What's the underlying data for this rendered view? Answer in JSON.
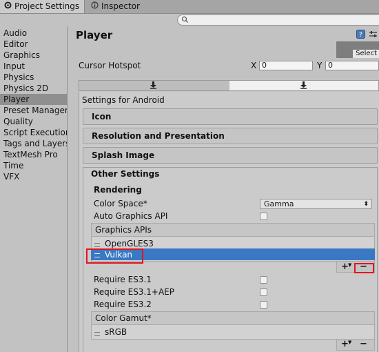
{
  "tabs": [
    {
      "label": "Project Settings",
      "icon": "gear-icon"
    },
    {
      "label": "Inspector",
      "icon": "info-icon"
    }
  ],
  "sidebar": {
    "items": [
      "Audio",
      "Editor",
      "Graphics",
      "Input",
      "Physics",
      "Physics 2D",
      "Player",
      "Preset Manager",
      "Quality",
      "Script Execution",
      "Tags and Layers",
      "TextMesh Pro",
      "Time",
      "VFX"
    ],
    "selected": "Player"
  },
  "main": {
    "title": "Player",
    "select_button": "Select",
    "cursor_hotspot": {
      "label": "Cursor Hotspot",
      "x_label": "X",
      "x_value": "0",
      "y_label": "Y",
      "y_value": "0"
    },
    "settings_for": "Settings for Android",
    "sections": [
      "Icon",
      "Resolution and Presentation",
      "Splash Image",
      "Other Settings"
    ],
    "rendering": {
      "title": "Rendering",
      "color_space_label": "Color Space*",
      "color_space_value": "Gamma",
      "auto_graphics_api_label": "Auto Graphics API",
      "graphics_apis_header": "Graphics APIs",
      "graphics_apis": [
        "OpenGLES3",
        "Vulkan"
      ],
      "selected_api": "Vulkan",
      "require_es31": "Require ES3.1",
      "require_es31_aep": "Require ES3.1+AEP",
      "require_es32": "Require ES3.2",
      "color_gamut_header": "Color Gamut*",
      "color_gamut_items": [
        "sRGB"
      ]
    },
    "plus_label": "+",
    "minus_label": "−"
  },
  "colors": {
    "selection": "#3a78c3",
    "highlight": "#e3141e"
  }
}
